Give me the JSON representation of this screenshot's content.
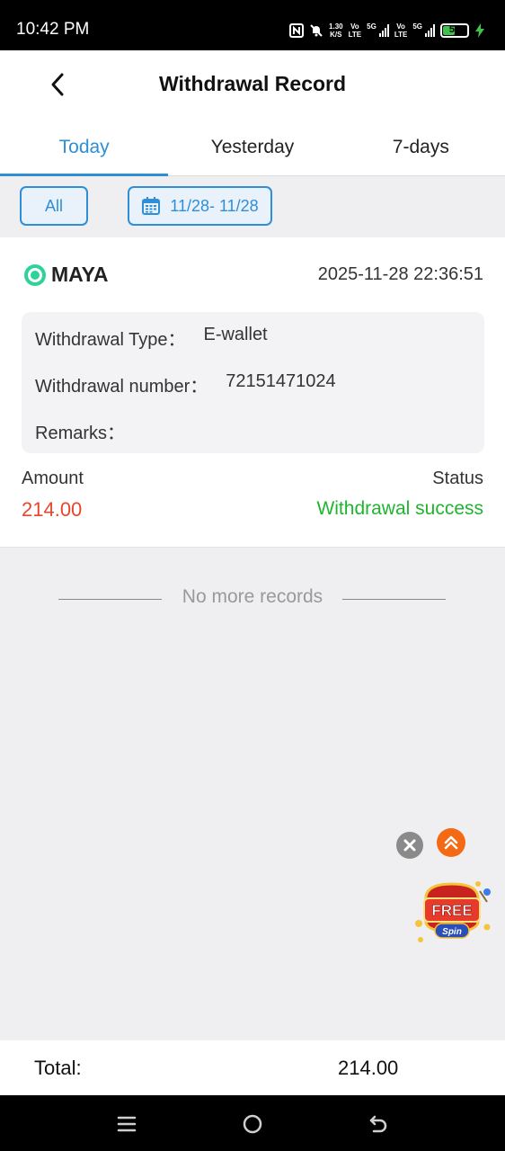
{
  "status_bar": {
    "time": "10:42 PM",
    "net_speed_value": "1.30",
    "net_speed_unit": "K/S",
    "vo_label": "Vo",
    "lte_label": "LTE",
    "g5_label": "5G",
    "battery_level": "55",
    "battery_color": "#3ec24a"
  },
  "header": {
    "title": "Withdrawal Record"
  },
  "tabs": [
    {
      "label": "Today",
      "active": true
    },
    {
      "label": "Yesterday",
      "active": false
    },
    {
      "label": "7-days",
      "active": false
    }
  ],
  "filters": {
    "all_label": "All",
    "date_range": "11/28- 11/28"
  },
  "record": {
    "provider": "MAYA",
    "datetime": "2025-11-28 22:36:51",
    "withdrawal_type_label": "Withdrawal Type：",
    "withdrawal_type_value": "E-wallet",
    "withdrawal_number_label": "Withdrawal number：",
    "withdrawal_number_value": "72151471024",
    "remarks_label": "Remarks：",
    "remarks_value": "",
    "amount_label": "Amount",
    "amount_value": "214.00",
    "status_label": "Status",
    "status_value": "Withdrawal success"
  },
  "list_end_text": "No more records",
  "floating": {
    "spin_word1": "FREE",
    "spin_word2": "Spin"
  },
  "total": {
    "label": "Total:",
    "value": "214.00"
  },
  "colors": {
    "accent": "#2e8fd6",
    "amount": "#e8452c",
    "success": "#1fb52f",
    "maya_brand": "#2fd39a"
  },
  "icons": {
    "back": "chevron-left-icon",
    "calendar": "calendar-icon",
    "maya_logo": "maya-logo-icon",
    "close_float": "close-icon",
    "scroll_top": "double-chevron-up-icon",
    "nav_menu": "menu-icon",
    "nav_home": "home-circle-icon",
    "nav_back": "back-arrow-icon"
  }
}
